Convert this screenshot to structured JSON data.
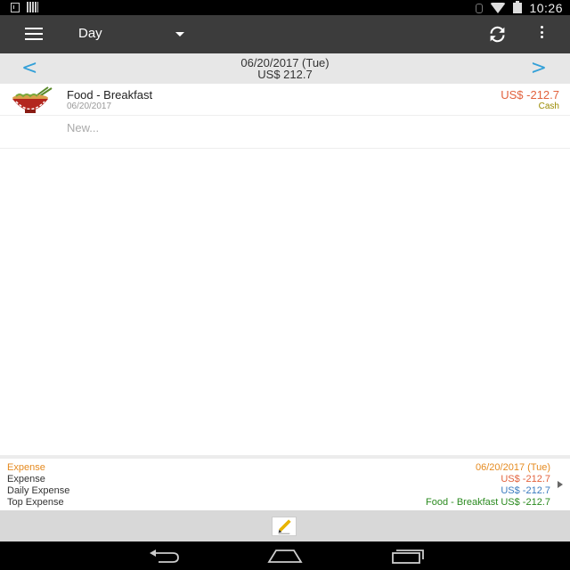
{
  "status_bar": {
    "time": "10:26",
    "left_icons": [
      "download-icon",
      "barcode-icon"
    ],
    "right_icons": [
      "bluetooth-icon",
      "wifi-icon",
      "battery-icon"
    ]
  },
  "toolbar": {
    "view_mode": "Day",
    "icons": [
      "menu-icon",
      "dropdown-caret-icon",
      "sync-icon",
      "more-vert-icon"
    ]
  },
  "date_header": {
    "date": "06/20/2017 (Tue)",
    "total": "US$ 212.7",
    "prev_symbol": "<",
    "next_symbol": ">"
  },
  "entries": [
    {
      "icon": "noodle-bowl-icon",
      "category": "Food - Breakfast",
      "date": "06/20/2017",
      "amount": "US$ -212.7",
      "account": "Cash"
    }
  ],
  "new_entry_placeholder": "New...",
  "summary": {
    "title": "Expense",
    "date": "06/20/2017 (Tue)",
    "rows": [
      {
        "label": "Expense",
        "value": "US$ -212.7"
      },
      {
        "label": "Daily Expense",
        "value": "US$ -212.7"
      },
      {
        "label": "Top Expense",
        "value": "Food - Breakfast US$ -212.7"
      }
    ]
  },
  "bottom_toolbar": {
    "icons": [
      "edit-pencil-icon"
    ]
  },
  "system_nav": {
    "icons": [
      "back-icon",
      "home-icon",
      "recents-icon"
    ]
  },
  "colors": {
    "toolbar": "#3c3c3c",
    "accent_blue": "#33a0d8",
    "expense_red": "#e2623d",
    "summary_orange": "#e58a1f",
    "summary_green": "#2a8a1f",
    "account_olive": "#9a8a00"
  }
}
